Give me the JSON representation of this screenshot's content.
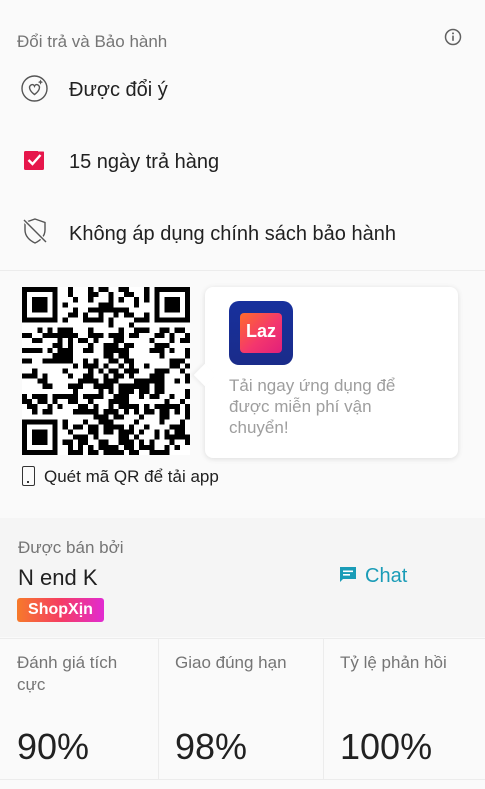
{
  "warranty": {
    "title": "Đổi trả và Bảo hành",
    "items": [
      {
        "label": "Được đổi ý",
        "icon": "heart-badge-icon"
      },
      {
        "label": "15 ngày trả hàng",
        "icon": "checkbox-checked-icon"
      },
      {
        "label": "Không áp dụng chính sách bảo hành",
        "icon": "shield-off-icon"
      }
    ]
  },
  "app_promo": {
    "qr_caption": "Quét mã QR để tải app",
    "logo_text": "Laz",
    "message": "Tải ngay ứng dụng để được miễn phí vận chuyển!"
  },
  "seller": {
    "sold_by_label": "Được bán bởi",
    "name": "N end K",
    "badge": "ShopXịn",
    "chat_label": "Chat",
    "stats": [
      {
        "title": "Đánh giá tích cực",
        "value": "90%"
      },
      {
        "title": "Giao đúng hạn",
        "value": "98%"
      },
      {
        "title": "Tỷ lệ phản hồi",
        "value": "100%"
      }
    ]
  },
  "colors": {
    "accent": "#1a9cb7",
    "check_red": "#e6164b",
    "muted_text": "#757575"
  }
}
